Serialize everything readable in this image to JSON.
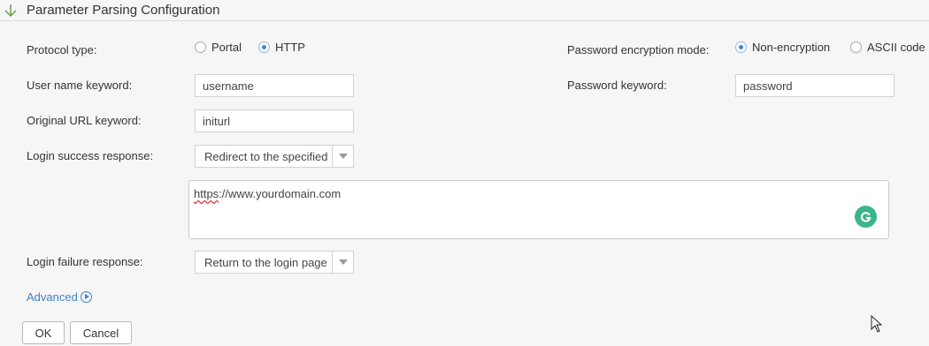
{
  "section": {
    "title": "Parameter Parsing Configuration"
  },
  "protocol": {
    "label": "Protocol type:",
    "options": [
      {
        "label": "Portal",
        "selected": false
      },
      {
        "label": "HTTP",
        "selected": true
      }
    ]
  },
  "encryption": {
    "label": "Password encryption mode:",
    "options": [
      {
        "label": "Non-encryption",
        "selected": true
      },
      {
        "label": "ASCII code",
        "selected": false
      }
    ]
  },
  "username_keyword": {
    "label": "User name keyword:",
    "value": "username"
  },
  "password_keyword": {
    "label": "Password keyword:",
    "value": "password"
  },
  "url_keyword": {
    "label": "Original URL keyword:",
    "value": "initurl"
  },
  "login_success": {
    "label": "Login success response:",
    "selected": "Redirect to the specified",
    "redirect_url_prefix": "https",
    "redirect_url_rest": "://www.yourdomain.com"
  },
  "login_failure": {
    "label": "Login failure response:",
    "selected": "Return to the login page"
  },
  "advanced": {
    "label": "Advanced"
  },
  "buttons": {
    "ok": "OK",
    "cancel": "Cancel"
  },
  "colors": {
    "link": "#3f7fc8",
    "radio_selected": "#3c87d6",
    "grammarly": "#3bb58c"
  }
}
